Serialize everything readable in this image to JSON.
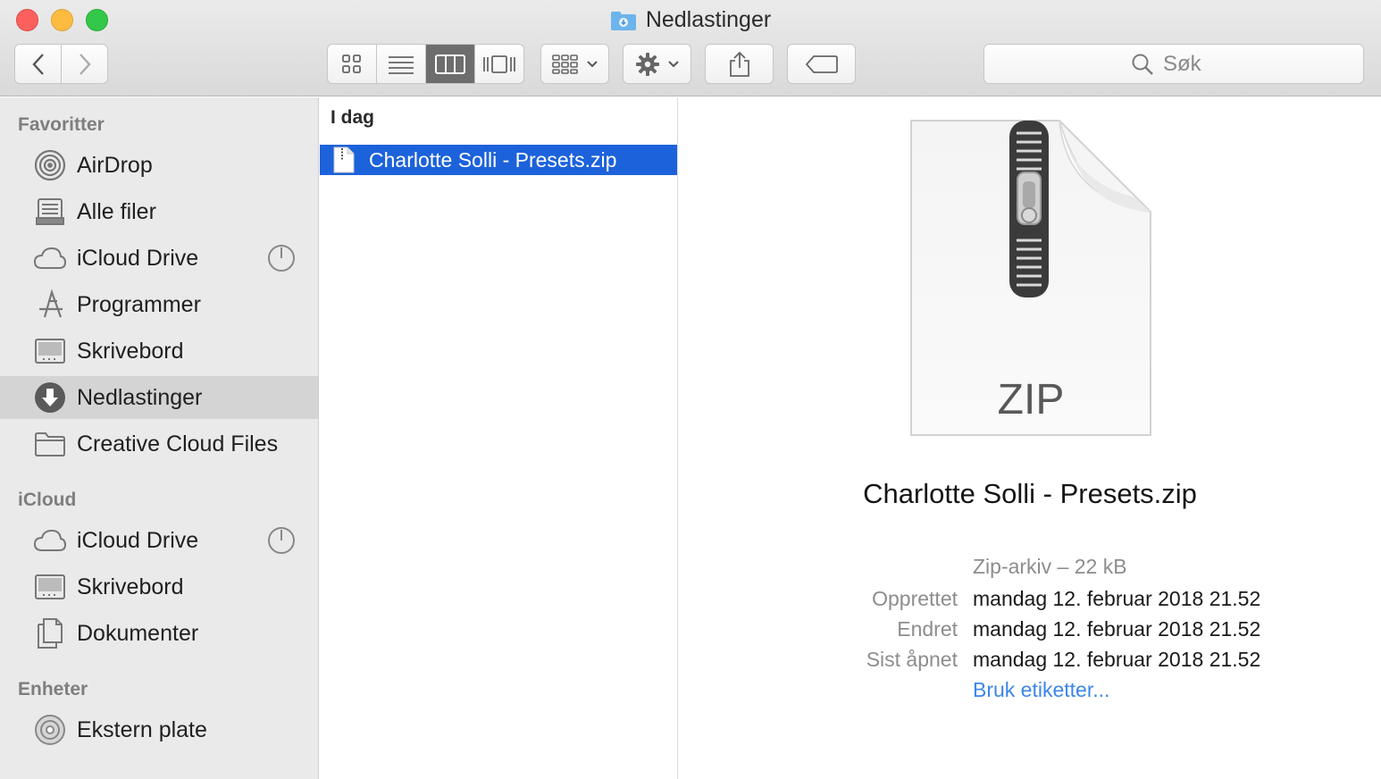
{
  "window": {
    "title": "Nedlastinger"
  },
  "toolbar": {
    "search_placeholder": "Søk"
  },
  "sidebar": {
    "sections": [
      {
        "header": "Favoritter",
        "items": [
          {
            "label": "AirDrop",
            "icon": "airdrop-icon"
          },
          {
            "label": "Alle filer",
            "icon": "all-files-icon"
          },
          {
            "label": "iCloud Drive",
            "icon": "cloud-icon"
          },
          {
            "label": "Programmer",
            "icon": "applications-icon"
          },
          {
            "label": "Skrivebord",
            "icon": "desktop-icon"
          },
          {
            "label": "Nedlastinger",
            "icon": "downloads-icon"
          },
          {
            "label": "Creative Cloud Files",
            "icon": "folder-icon"
          }
        ]
      },
      {
        "header": "iCloud",
        "items": [
          {
            "label": "iCloud Drive",
            "icon": "cloud-icon"
          },
          {
            "label": "Skrivebord",
            "icon": "desktop-icon"
          },
          {
            "label": "Dokumenter",
            "icon": "documents-icon"
          }
        ]
      },
      {
        "header": "Enheter",
        "items": [
          {
            "label": "Ekstern plate",
            "icon": "disc-icon"
          }
        ]
      }
    ],
    "selected": "Nedlastinger"
  },
  "column": {
    "header": "I dag",
    "files": [
      {
        "name": "Charlotte Solli - Presets.zip",
        "selected": true
      }
    ]
  },
  "preview": {
    "icon_label": "ZIP",
    "name": "Charlotte Solli - Presets.zip",
    "kind": "Zip-arkiv – 22 kB",
    "rows": [
      {
        "label": "Opprettet",
        "value": "mandag 12. februar 2018 21.52"
      },
      {
        "label": "Endret",
        "value": "mandag 12. februar 2018 21.52"
      },
      {
        "label": "Sist åpnet",
        "value": "mandag 12. februar 2018 21.52"
      }
    ],
    "tags_link": "Bruk etiketter..."
  },
  "colors": {
    "selection": "#1c62db",
    "link": "#3c86e8",
    "sidebar_bg": "#eaeaea"
  }
}
